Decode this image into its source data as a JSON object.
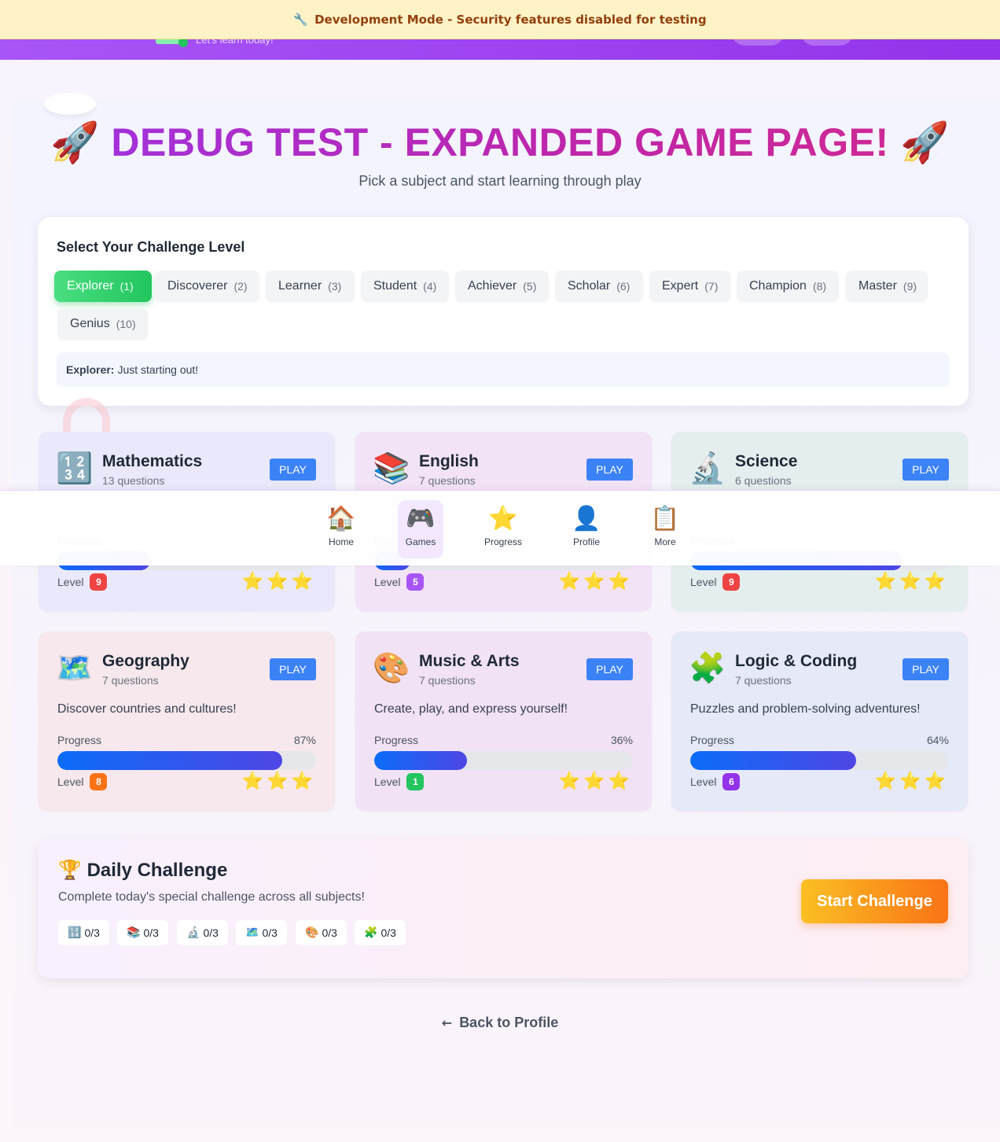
{
  "dev_banner": {
    "icon": "🔧",
    "text": "Development Mode - Security features disabled for testing"
  },
  "header": {
    "tagline": "Let's learn today!"
  },
  "title": {
    "left_icon": "🚀",
    "text": "DEBUG TEST - EXPANDED GAME PAGE!",
    "right_icon": "🚀"
  },
  "subtitle": "Pick a subject and start learning through play",
  "level_select": {
    "heading": "Select Your Challenge Level",
    "levels": [
      {
        "label": "Explorer",
        "num": "(1)"
      },
      {
        "label": "Discoverer",
        "num": "(2)"
      },
      {
        "label": "Learner",
        "num": "(3)"
      },
      {
        "label": "Student",
        "num": "(4)"
      },
      {
        "label": "Achiever",
        "num": "(5)"
      },
      {
        "label": "Scholar",
        "num": "(6)"
      },
      {
        "label": "Expert",
        "num": "(7)"
      },
      {
        "label": "Champion",
        "num": "(8)"
      },
      {
        "label": "Master",
        "num": "(9)"
      },
      {
        "label": "Genius",
        "num": "(10)"
      }
    ],
    "selected": "Explorer",
    "description_name": "Explorer:",
    "description_text": "Just starting out!"
  },
  "subjects": [
    {
      "icon": "🔢",
      "name": "Mathematics",
      "questions": "13 questions",
      "play": "PLAY",
      "description": "",
      "progress_label": "Progress",
      "progress": 0.36,
      "progress_text": "",
      "level_label": "Level",
      "level": "9",
      "level_color": "#ef4444",
      "stars": "⭐⭐⭐",
      "bg": "#eae9fb"
    },
    {
      "icon": "📚",
      "name": "English",
      "questions": "7 questions",
      "play": "PLAY",
      "description": "",
      "progress_label": "Progress",
      "progress": 0.14,
      "progress_text": "",
      "level_label": "Level",
      "level": "5",
      "level_color": "#a855f7",
      "stars": "⭐⭐⭐",
      "bg": "#f3e3f6"
    },
    {
      "icon": "🔬",
      "name": "Science",
      "questions": "6 questions",
      "play": "PLAY",
      "description": "",
      "progress_label": "Progress",
      "progress": 0.82,
      "progress_text": "",
      "level_label": "Level",
      "level": "9",
      "level_color": "#ef4444",
      "stars": "⭐⭐⭐",
      "bg": "#e5eeee"
    },
    {
      "icon": "🗺️",
      "name": "Geography",
      "questions": "7 questions",
      "play": "PLAY",
      "description": "Discover countries and cultures!",
      "progress_label": "Progress",
      "progress": 0.87,
      "progress_text": "87%",
      "level_label": "Level",
      "level": "8",
      "level_color": "#f97316",
      "stars": "⭐⭐⭐",
      "bg": "#f6e8ec"
    },
    {
      "icon": "🎨",
      "name": "Music & Arts",
      "questions": "7 questions",
      "play": "PLAY",
      "description": "Create, play, and express yourself!",
      "progress_label": "Progress",
      "progress": 0.36,
      "progress_text": "36%",
      "level_label": "Level",
      "level": "1",
      "level_color": "#22c55e",
      "stars": "⭐⭐⭐",
      "bg": "#f2e2f5"
    },
    {
      "icon": "🧩",
      "name": "Logic & Coding",
      "questions": "7 questions",
      "play": "PLAY",
      "description": "Puzzles and problem-solving adventures!",
      "progress_label": "Progress",
      "progress": 0.64,
      "progress_text": "64%",
      "level_label": "Level",
      "level": "6",
      "level_color": "#9333ea",
      "stars": "⭐⭐⭐",
      "bg": "#e6e9f8"
    }
  ],
  "bottom_nav": [
    {
      "icon": "🏠",
      "label": "Home"
    },
    {
      "icon": "🎮",
      "label": "Games"
    },
    {
      "icon": "⭐",
      "label": "Progress"
    },
    {
      "icon": "👤",
      "label": "Profile"
    },
    {
      "icon": "📋",
      "label": "More"
    }
  ],
  "bottom_nav_active": "Games",
  "daily_challenge": {
    "icon": "🏆",
    "title": "Daily Challenge",
    "subtitle": "Complete today's special challenge across all subjects!",
    "items": [
      {
        "icon": "🔢",
        "score": "0/3"
      },
      {
        "icon": "📚",
        "score": "0/3"
      },
      {
        "icon": "🔬",
        "score": "0/3"
      },
      {
        "icon": "🗺️",
        "score": "0/3"
      },
      {
        "icon": "🎨",
        "score": "0/3"
      },
      {
        "icon": "🧩",
        "score": "0/3"
      }
    ],
    "button": "Start Challenge"
  },
  "back_link": {
    "arrow": "←",
    "label": "Back to Profile"
  }
}
